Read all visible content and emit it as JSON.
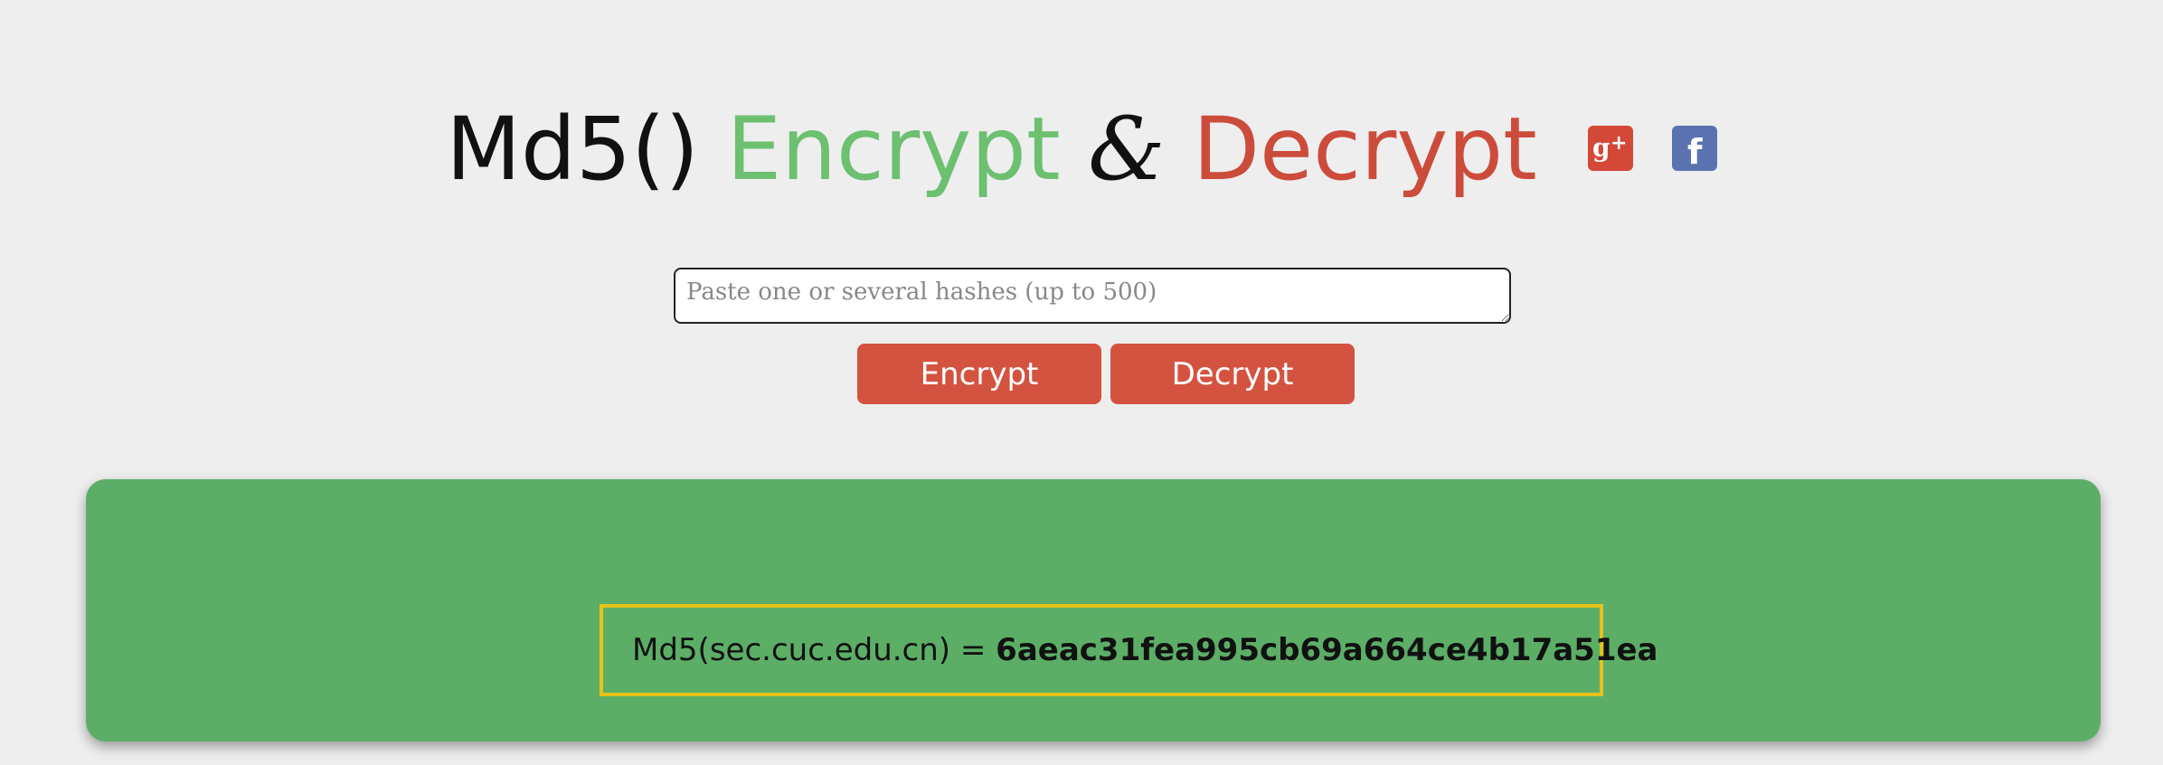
{
  "header": {
    "title_md5": "Md5()",
    "title_encrypt": "Encrypt",
    "title_amp": "&",
    "title_decrypt": "Decrypt",
    "icons": [
      "google-plus-icon",
      "facebook-icon"
    ],
    "colors": {
      "encrypt_word": "#6cc070",
      "decrypt_word": "#cc4c3b",
      "google_plus": "#d34836",
      "facebook": "#5a72b0"
    }
  },
  "form": {
    "input_value": "",
    "input_placeholder": "Paste one or several hashes (up to 500)",
    "encrypt_label": "Encrypt",
    "decrypt_label": "Decrypt",
    "button_color": "#d35340"
  },
  "result": {
    "prefix": "Md5(sec.cuc.edu.cn) = ",
    "hash": "6aeac31fea995cb69a664ce4b17a51ea",
    "panel_color": "#5cae67",
    "border_color": "#e6c21a"
  }
}
